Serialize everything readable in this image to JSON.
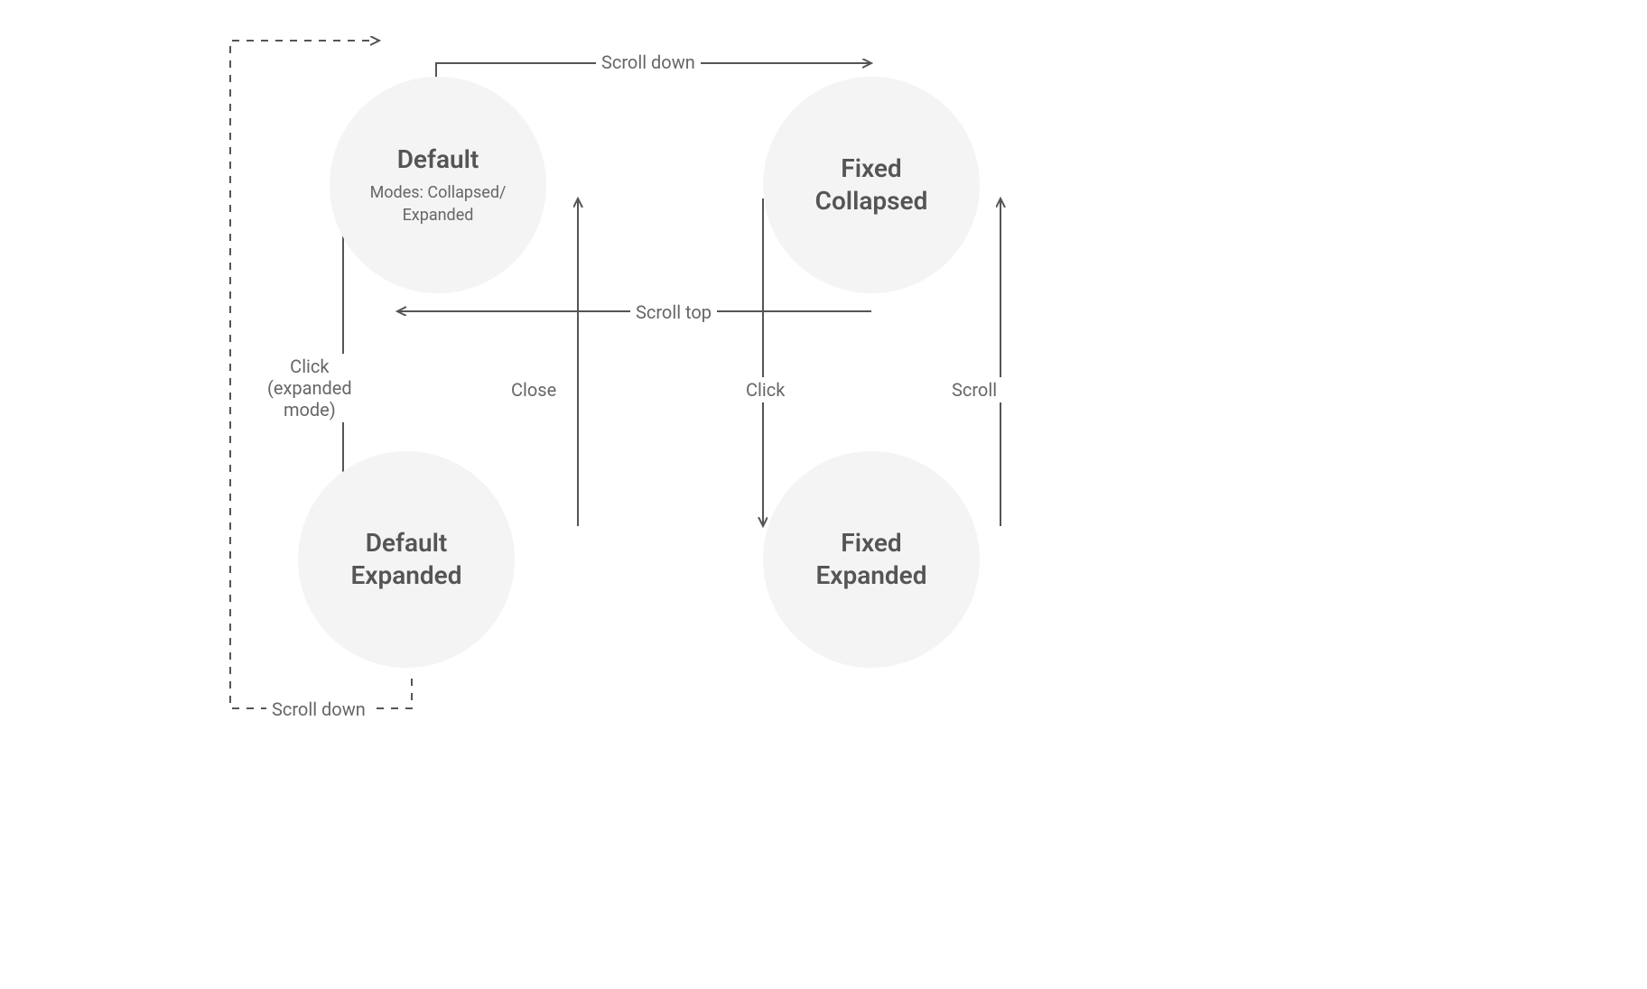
{
  "nodes": {
    "default": {
      "title": "Default",
      "subtitle": "Modes: Collapsed/\nExpanded"
    },
    "fixedCollapsed": {
      "title": "Fixed\nCollapsed"
    },
    "defaultExpanded": {
      "title": "Default\nExpanded"
    },
    "fixedExpanded": {
      "title": "Fixed\nExpanded"
    }
  },
  "edges": {
    "scrollDown": "Scroll down",
    "scrollTop": "Scroll top",
    "clickExpandedMode": "Click\n(expanded\nmode)",
    "close": "Close",
    "click": "Click",
    "scroll": "Scroll",
    "scrollDownDashed": "Scroll down"
  }
}
